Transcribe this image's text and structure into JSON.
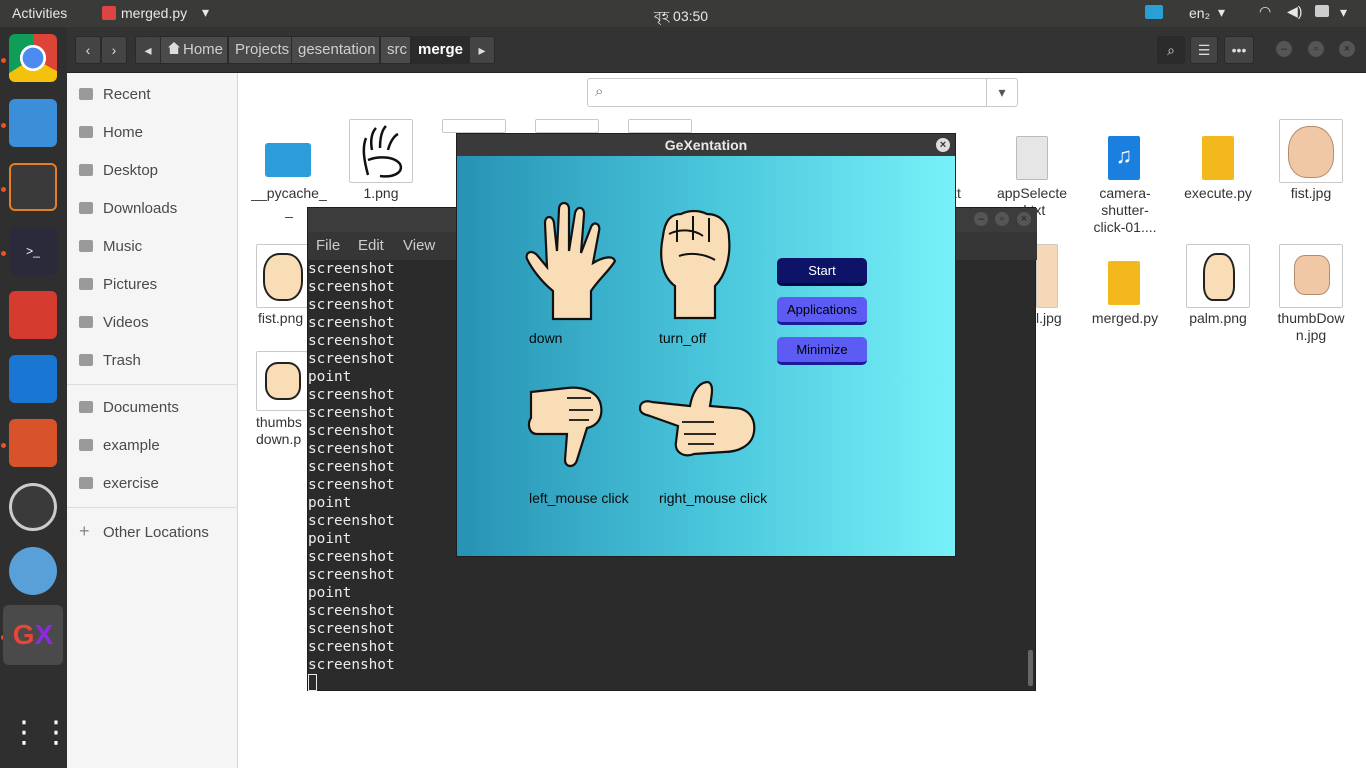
{
  "topbar": {
    "activities": "Activities",
    "app_name": "merged.py",
    "clock": "বৃহ 03:50",
    "lang": "en₂"
  },
  "nautilus": {
    "path": [
      "Home",
      "Projects",
      "gesentation",
      "src",
      "merge"
    ],
    "search_placeholder": ""
  },
  "sidebar": {
    "items": [
      "Recent",
      "Home",
      "Desktop",
      "Downloads",
      "Music",
      "Pictures",
      "Videos",
      "Trash"
    ],
    "bookmarks": [
      "Documents",
      "example",
      "exercise"
    ],
    "other": "Other Locations"
  },
  "files": {
    "row1": [
      "__pycache_\n_",
      "1.png",
      "appSelecte\nd.txt",
      "camera-\nshutter-\nclick-01....",
      "execute.py",
      "fist.jpg"
    ],
    "row2": [
      "fist.png",
      "l.jpg",
      "merged.py",
      "palm.png",
      "thumbDow\nn.jpg"
    ],
    "row3": [
      "thumbs\ndown.p"
    ],
    "partial_txt": "xt"
  },
  "terminal": {
    "menu": [
      "File",
      "Edit",
      "View"
    ],
    "lines": [
      "screenshot",
      "screenshot",
      "screenshot",
      "screenshot",
      "screenshot",
      "screenshot",
      "point",
      "screenshot",
      "screenshot",
      "screenshot",
      "screenshot",
      "screenshot",
      "screenshot",
      "point",
      "screenshot",
      "point",
      "screenshot",
      "screenshot",
      "point",
      "screenshot",
      "screenshot",
      "screenshot",
      "screenshot"
    ]
  },
  "gexentation": {
    "title": "GeXentation",
    "gestures": [
      "down",
      "turn_off",
      "left_mouse click",
      "right_mouse click"
    ],
    "buttons": {
      "start": "Start",
      "applications": "Applications",
      "minimize": "Minimize"
    },
    "colors": {
      "start_bg": "#0d1468",
      "btn_bg": "#5c5cf5"
    }
  }
}
